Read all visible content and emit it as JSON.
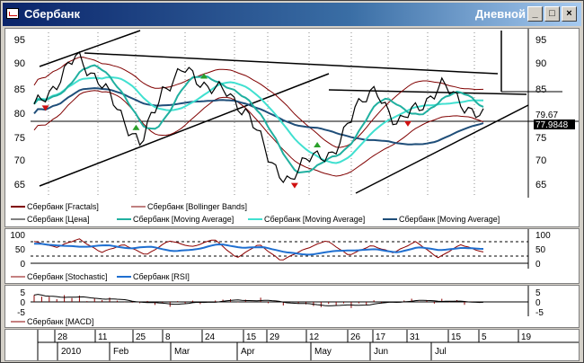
{
  "window": {
    "title": "Сбербанк",
    "period": "Дневной"
  },
  "controls": {
    "minimize": "_",
    "maximize": "□",
    "close": "×"
  },
  "colors": {
    "price": "#000000",
    "fractal_up": "#2aa02a",
    "fractal_down": "#d01010",
    "bollinger": "#800000",
    "ma_fast": "#20c0c0",
    "ma_mid": "#40e0d0",
    "ma_slow": "#1f4e79",
    "rsi": "#1f6fd0",
    "stochastic": "#8b0000",
    "macd": "#8b0000"
  },
  "main": {
    "y_ticks": [
      95,
      90,
      85,
      80,
      75,
      70,
      65
    ],
    "price_labels": {
      "last": "79.67",
      "close": "77.9848"
    },
    "legend": [
      {
        "label": "Сбербанк [Fractals]"
      },
      {
        "label": "Сбербанк [Bollinger Bands]"
      },
      {
        "label": "Сбербанк [Цена]"
      },
      {
        "label": "Сбербанк [Moving Average]"
      },
      {
        "label": "Сбербанк [Moving Average]"
      },
      {
        "label": "Сбербанк [Moving Average]"
      }
    ]
  },
  "oscillator": {
    "y_ticks": [
      100,
      50,
      0
    ],
    "legend": [
      {
        "label": "Сбербанк [Stochastic]"
      },
      {
        "label": "Сбербанк [RSI]"
      }
    ]
  },
  "macd": {
    "y_ticks": [
      "5",
      "0",
      "-5"
    ],
    "legend": [
      {
        "label": "Сбербанк [MACD]"
      }
    ]
  },
  "time_axis": {
    "days": [
      "28",
      "11",
      "25",
      "8",
      "24",
      "15",
      "29",
      "12",
      "26",
      "17",
      "31",
      "15",
      "5",
      "19"
    ],
    "months": [
      "2010",
      "Feb",
      "Mar",
      "Apr",
      "May",
      "Jun",
      "Jul"
    ]
  },
  "chart_data": {
    "type": "line",
    "x": [
      "Jan 28",
      "Feb 11",
      "Feb 25",
      "Mar 8",
      "Mar 24",
      "Apr 15",
      "Apr 29",
      "May 12",
      "May 26",
      "Jun 17",
      "Jun 31",
      "Jul 15",
      "Jul 5",
      "Jul 19"
    ],
    "series": [
      {
        "name": "Сбербанк [Цена]",
        "values": [
          81,
          86,
          92,
          87,
          80,
          73,
          85,
          89,
          86,
          84,
          80,
          70,
          65,
          72,
          70,
          82,
          84,
          78,
          81,
          86,
          82,
          79
        ]
      },
      {
        "name": "Сбербанк [RSI]",
        "values": [
          72,
          66,
          60,
          68,
          55,
          62,
          45,
          50,
          72,
          58,
          60,
          42,
          30,
          44,
          48,
          52,
          40,
          60,
          48,
          58,
          52
        ]
      },
      {
        "name": "Сбербанк [Stochastic]",
        "values": [
          80,
          60,
          90,
          40,
          70,
          30,
          85,
          60,
          90,
          20,
          70,
          10,
          50,
          85,
          30,
          65,
          40,
          80,
          20,
          70,
          40
        ]
      },
      {
        "name": "Сбербанк [MACD]",
        "values": [
          3.5,
          3.2,
          2.6,
          1.8,
          0.5,
          -1.0,
          -1.3,
          -0.4,
          0.6,
          1.2,
          0.8,
          -0.6,
          -1.8,
          -2.4,
          -2.1,
          -0.9,
          0.4,
          0.9,
          0.5,
          -0.2,
          0.3
        ]
      }
    ],
    "ylim": [
      62,
      97
    ]
  }
}
